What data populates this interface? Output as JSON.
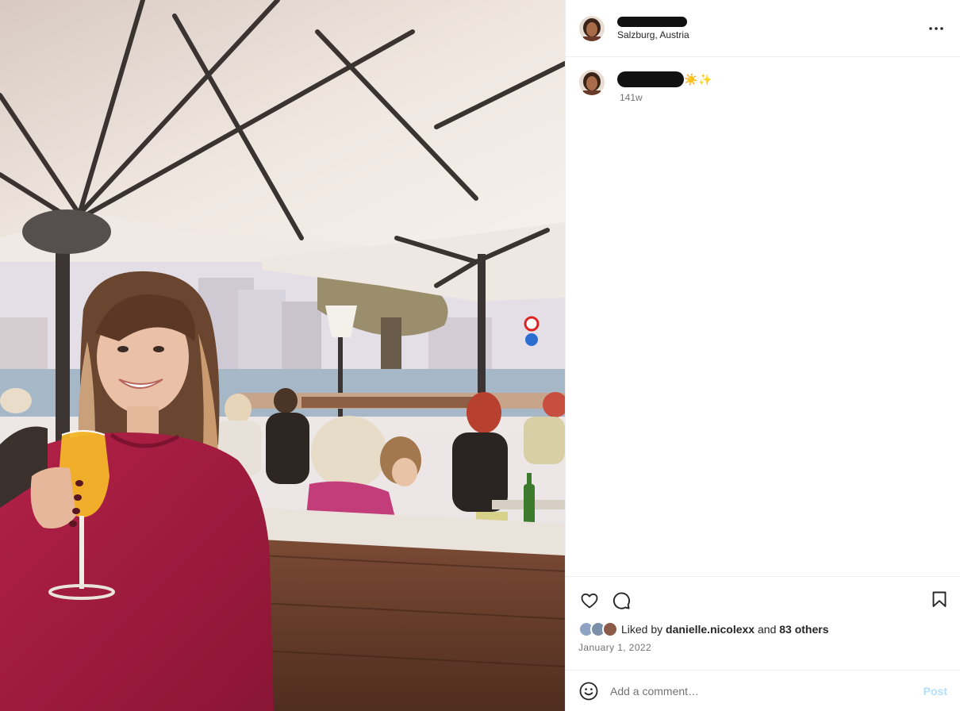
{
  "post": {
    "location": "Salzburg, Austria",
    "caption_emojis": "☀️✨",
    "caption_age": "141w",
    "date": "January 1, 2022"
  },
  "likes": {
    "prefix": "Liked by ",
    "first_liker": "danielle.nicolexx",
    "middle": " and ",
    "others": "83 others"
  },
  "comment": {
    "placeholder": "Add a comment…",
    "post_label": "Post"
  },
  "icons": {
    "more": "more-options-icon",
    "like": "heart-icon",
    "comment": "speech-bubble-icon",
    "save": "bookmark-icon",
    "emoji": "smiley-icon"
  },
  "colors": {
    "post_disabled": "#b2dffc",
    "secondary_text": "#737373",
    "sweater": "#a31c3f",
    "drink": "#f2b81e"
  }
}
